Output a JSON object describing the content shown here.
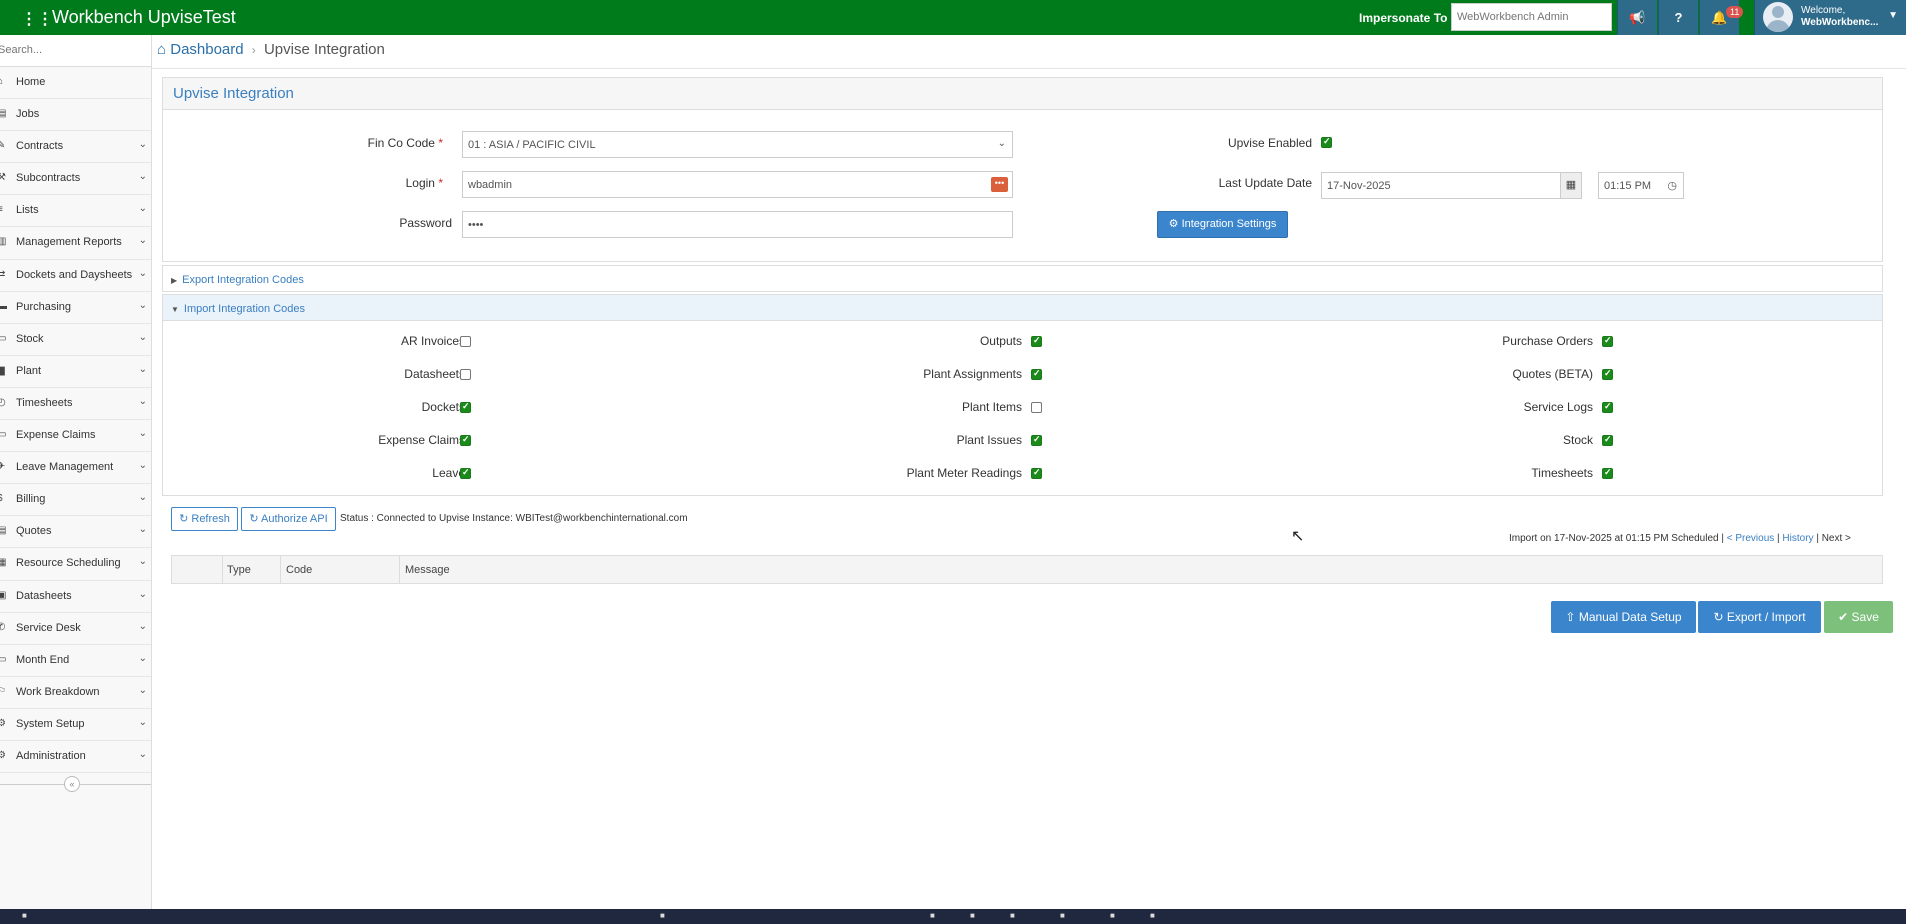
{
  "app": {
    "title": "Workbench UpviseTest",
    "apps_icon": "grid-icon"
  },
  "topbar": {
    "impersonate_label": "Impersonate To",
    "impersonate_value": "WebWorkbench Admin",
    "notification_count": "11",
    "welcome": "Welcome,",
    "user_name": "WebWorkbenc..."
  },
  "sidebar": {
    "search_placeholder": "Search...",
    "items": [
      {
        "label": "Home",
        "icon": "home-icon",
        "expandable": false
      },
      {
        "label": "Jobs",
        "icon": "jobs-icon",
        "expandable": false
      },
      {
        "label": "Contracts",
        "icon": "contracts-icon",
        "expandable": true
      },
      {
        "label": "Subcontracts",
        "icon": "subcontracts-icon",
        "expandable": true
      },
      {
        "label": "Lists",
        "icon": "lists-icon",
        "expandable": true
      },
      {
        "label": "Management Reports",
        "icon": "reports-icon",
        "expandable": true
      },
      {
        "label": "Dockets and Daysheets",
        "icon": "dockets-icon",
        "expandable": true
      },
      {
        "label": "Purchasing",
        "icon": "purchasing-icon",
        "expandable": true
      },
      {
        "label": "Stock",
        "icon": "stock-icon",
        "expandable": true
      },
      {
        "label": "Plant",
        "icon": "plant-icon",
        "expandable": true
      },
      {
        "label": "Timesheets",
        "icon": "timesheets-icon",
        "expandable": true
      },
      {
        "label": "Expense Claims",
        "icon": "expense-icon",
        "expandable": true
      },
      {
        "label": "Leave Management",
        "icon": "leave-icon",
        "expandable": true
      },
      {
        "label": "Billing",
        "icon": "billing-icon",
        "expandable": true
      },
      {
        "label": "Quotes",
        "icon": "quotes-icon",
        "expandable": true
      },
      {
        "label": "Resource Scheduling",
        "icon": "resource-icon",
        "expandable": true
      },
      {
        "label": "Datasheets",
        "icon": "datasheets-icon",
        "expandable": true
      },
      {
        "label": "Service Desk",
        "icon": "service-desk-icon",
        "expandable": true
      },
      {
        "label": "Month End",
        "icon": "month-end-icon",
        "expandable": true
      },
      {
        "label": "Work Breakdown",
        "icon": "work-breakdown-icon",
        "expandable": true
      },
      {
        "label": "System Setup",
        "icon": "system-setup-icon",
        "expandable": true
      },
      {
        "label": "Administration",
        "icon": "administration-icon",
        "expandable": true
      }
    ]
  },
  "breadcrumb": {
    "home": "Dashboard",
    "current": "Upvise Integration"
  },
  "panel": {
    "title": "Upvise Integration",
    "fin_co_code_label": "Fin Co Code",
    "fin_co_code_value": "01 : ASIA / PACIFIC CIVIL",
    "login_label": "Login",
    "login_value": "wbadmin",
    "password_label": "Password",
    "password_value": "••••",
    "upvise_enabled_label": "Upvise Enabled",
    "upvise_enabled": true,
    "last_update_label": "Last Update Date",
    "last_update_date": "17-Nov-2025",
    "last_update_time": "01:15 PM",
    "integration_settings_label": "Integration Settings"
  },
  "export_section": {
    "label": "Export Integration Codes"
  },
  "import_section": {
    "label": "Import Integration Codes",
    "col1": [
      {
        "label": "AR Invoices",
        "checked": false
      },
      {
        "label": "Datasheets",
        "checked": false
      },
      {
        "label": "Dockets",
        "checked": true
      },
      {
        "label": "Expense Claims",
        "checked": true
      },
      {
        "label": "Leave",
        "checked": true
      }
    ],
    "col2": [
      {
        "label": "Outputs",
        "checked": true
      },
      {
        "label": "Plant Assignments",
        "checked": true
      },
      {
        "label": "Plant Items",
        "checked": false
      },
      {
        "label": "Plant Issues",
        "checked": true
      },
      {
        "label": "Plant Meter Readings",
        "checked": true
      }
    ],
    "col3": [
      {
        "label": "Purchase Orders",
        "checked": true
      },
      {
        "label": "Quotes (BETA)",
        "checked": true
      },
      {
        "label": "Service Logs",
        "checked": true
      },
      {
        "label": "Stock",
        "checked": true
      },
      {
        "label": "Timesheets",
        "checked": true
      }
    ]
  },
  "actions": {
    "refresh": "Refresh",
    "authorize": "Authorize API",
    "status": "Status : Connected to Upvise Instance: WBITest@workbenchinternational.com"
  },
  "import_nav": {
    "text": "Import on 17-Nov-2025 at 01:15 PM Scheduled |",
    "previous": "< Previous",
    "history": "History",
    "next": "Next >"
  },
  "table": {
    "columns": [
      "",
      "Type",
      "Code",
      "Message"
    ]
  },
  "buttons": {
    "manual_setup": "Manual Data Setup",
    "export_import": "Export / Import",
    "save": "Save"
  },
  "colors": {
    "topbar": "#007b1c",
    "accent": "#3a85cc",
    "save": "#5cb85c"
  }
}
